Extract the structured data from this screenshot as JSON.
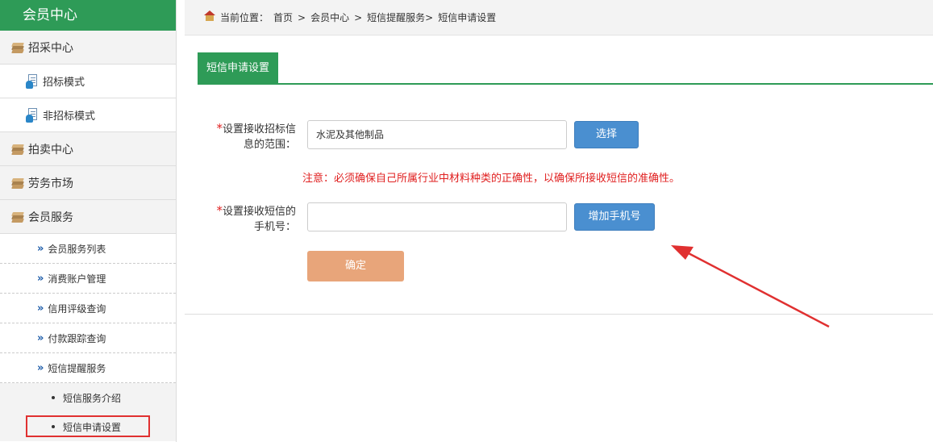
{
  "sidebar": {
    "title": "会员中心",
    "sections": {
      "zhaocai": "招采中心",
      "paimai": "拍卖中心",
      "laowu": "劳务市场",
      "huiyuan": "会员服务"
    },
    "docs": {
      "zhaobiao": "招标模式",
      "feizhaobiao": "非招标模式"
    },
    "subs": {
      "list": "会员服务列表",
      "account": "消费账户管理",
      "credit": "信用评级查询",
      "payment": "付款跟踪查询",
      "sms": "短信提醒服务"
    },
    "leaves": {
      "intro": "短信服务介绍",
      "apply": "短信申请设置"
    }
  },
  "breadcrumb": {
    "prefix": "当前位置：",
    "items": [
      "首页",
      ">",
      "会员中心",
      ">",
      "短信提醒服务>",
      "短信申请设置"
    ]
  },
  "tab": {
    "label": "短信申请设置"
  },
  "form": {
    "range_label_1": "设置接收招标信",
    "range_label_2": "息的范围：",
    "range_value": "水泥及其他制品",
    "select_button": "选择",
    "notice": "注意：必须确保自己所属行业中材料种类的正确性，以确保所接收短信的准确性。",
    "phone_label_1": "设置接收短信的",
    "phone_label_2": "手机号：",
    "phone_value": "",
    "add_phone_button": "增加手机号",
    "confirm_button": "确定",
    "required_mark": "*"
  },
  "colors": {
    "brand_green": "#2e9b57",
    "accent_blue": "#4a8fd0",
    "warn_red": "#e02020",
    "confirm_orange": "#e8a57a"
  }
}
